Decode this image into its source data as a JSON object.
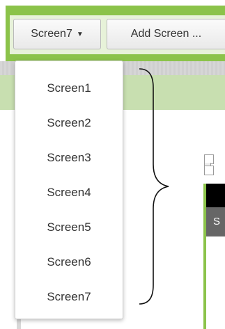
{
  "toolbar": {
    "screen_selector_label": "Screen7",
    "add_screen_label": "Add Screen ..."
  },
  "dropdown": {
    "items": [
      "Screen1",
      "Screen2",
      "Screen3",
      "Screen4",
      "Screen5",
      "Screen6",
      "Screen7"
    ]
  },
  "viewer": {
    "title_bar_letter": "S"
  },
  "colors": {
    "accent_green": "#8bc34a",
    "light_green": "#c8dfb0"
  }
}
